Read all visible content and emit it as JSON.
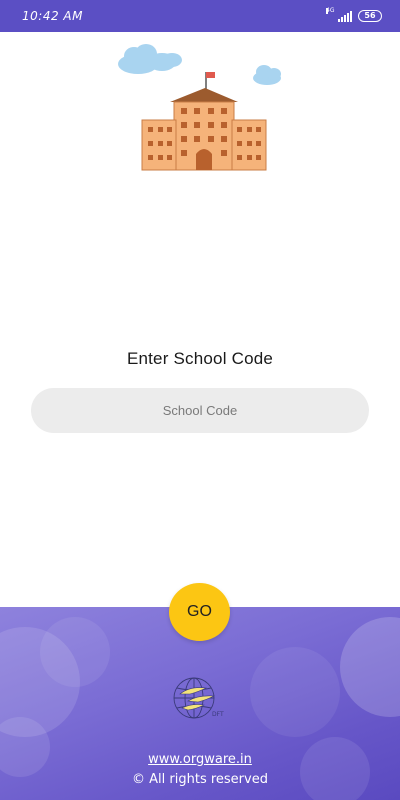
{
  "status_bar": {
    "time": "10:42 AM",
    "network_label": "4G",
    "battery_level": "56",
    "icons": [
      "signal-icon",
      "battery-icon"
    ]
  },
  "illustration": {
    "name": "school-building-illustration"
  },
  "form": {
    "title": "Enter School Code",
    "school_code_placeholder": "School Code",
    "school_code_value": "",
    "go_label": "GO"
  },
  "footer": {
    "website": "www.orgware.in",
    "copyright": "© All rights reserved"
  },
  "colors": {
    "status_bar": "#5b4fc4",
    "accent_button": "#fcc613",
    "footer_gradient": [
      "#8e82dd",
      "#5a4ac0"
    ],
    "input_bg": "#ececec"
  }
}
